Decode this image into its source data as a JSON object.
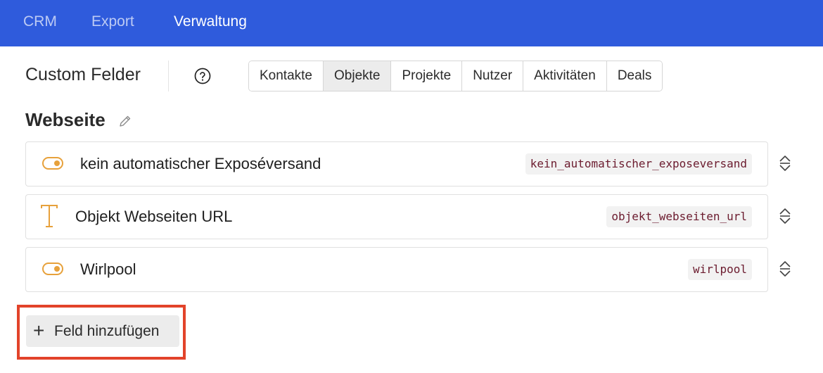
{
  "topnav": {
    "items": [
      {
        "label": "CRM"
      },
      {
        "label": "Export"
      },
      {
        "label": "Verwaltung"
      }
    ]
  },
  "header": {
    "title": "Custom Felder",
    "help_icon": "help-circle-icon"
  },
  "tabs": [
    {
      "label": "Kontakte"
    },
    {
      "label": "Objekte",
      "selected": true
    },
    {
      "label": "Projekte"
    },
    {
      "label": "Nutzer"
    },
    {
      "label": "Aktivitäten"
    },
    {
      "label": "Deals"
    }
  ],
  "section": {
    "title": "Webseite",
    "edit_icon": "pencil-icon"
  },
  "fields": [
    {
      "type_icon": "toggle-icon",
      "label": "kein automatischer Exposéversand",
      "key": "kein_automatischer_exposeversand"
    },
    {
      "type_icon": "text-type-icon",
      "label": "Objekt Webseiten URL",
      "key": "objekt_webseiten_url"
    },
    {
      "type_icon": "toggle-icon",
      "label": "Wirlpool",
      "key": "wirlpool"
    }
  ],
  "add_button": {
    "icon": "plus-icon",
    "label": "Feld hinzufügen"
  },
  "colors": {
    "topbar": "#2f5bdc",
    "accent_orange": "#e7a13b",
    "highlight_red": "#e2432a",
    "key_text": "#6b1b2e"
  }
}
